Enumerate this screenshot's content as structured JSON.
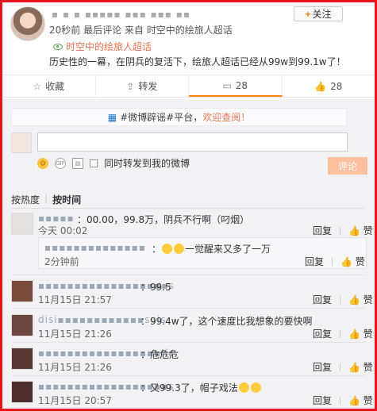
{
  "post": {
    "user_name": "▪ ▪ ▪ ▪▪▪▪▪ ▪▪▪ ▪▪▪ ▪▪",
    "follow_label": "关注",
    "meta": "20秒前 最后评论 来自 时空中的绘旅人超话",
    "topic": "时空中的绘旅人超话",
    "content": "历史性的一幕，在阴兵的复活下，绘旅人超话已经从99w到99.1w了！"
  },
  "actions": [
    {
      "icon": "star-icon",
      "label": "收藏"
    },
    {
      "icon": "share-icon",
      "label": "转发"
    },
    {
      "icon": "comment-icon",
      "label": "28"
    },
    {
      "icon": "like-icon",
      "label": "28"
    }
  ],
  "composer": {
    "notice_prefix": "#微博辟谣#平台，",
    "notice_highlight": "欢迎查阅！",
    "input_value": "",
    "share_label": "同时转发到我的微博",
    "post_label": "评论"
  },
  "sort": {
    "hot": "按热度",
    "time": "按时间"
  },
  "comments": [
    {
      "name": "▪▪▪▪▪",
      "text": "：00.00，99.8万，阴兵不行啊（叼烟）",
      "time": "今天 00:02",
      "reply": "回复",
      "like": "赞"
    },
    {
      "name": "▪▪▪▪▪▪▪▪▪▪▪▪▪▪",
      "text": "一觉醒来又多了一万",
      "time": "2分钟前",
      "reply": "回复",
      "like": "赞"
    },
    {
      "name": "▪▪▪▪▪▪▪▪▪▪▪▪▪▪▪▪▪▪s",
      "text": "：99.5",
      "time": "11月15日 21:57",
      "reply": "回复",
      "like": "赞"
    },
    {
      "name": "disi▪▪▪▪▪▪▪▪▪▪▪▪suis",
      "text": "：99.4w了，这个速度比我想象的要快啊",
      "time": "11月15日 21:26",
      "reply": "回复",
      "like": "赞"
    },
    {
      "name": "▪▪▪▪▪▪▪▪▪▪▪▪▪▪▪▪▪lic",
      "text": "：危危危",
      "time": "11月15日 21:26",
      "reply": "回复",
      "like": "赞"
    },
    {
      "name": "▪▪▪▪▪▪▪▪▪▪▪▪▪▪▪▪▪▪s",
      "text": "：又99.3了，帽子戏法",
      "time": "11月15日 20:57",
      "reply": "回复",
      "like": "赞"
    }
  ],
  "colors": {
    "border": "#e8141c",
    "accent": "#ff8200",
    "link": "#eb7350",
    "panel": "#f2f2f5"
  }
}
